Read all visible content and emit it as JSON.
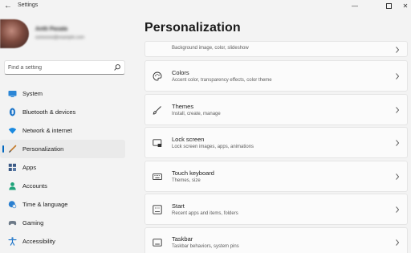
{
  "window": {
    "title": "Settings",
    "back_glyph": "←",
    "minimize_glyph": "—",
    "close_glyph": "✕"
  },
  "user": {
    "name": "Antti Pasala",
    "email": "someone@example.com"
  },
  "search": {
    "placeholder": "Find a setting",
    "icon": "search-icon"
  },
  "sidebar": {
    "accent": "#0067c0",
    "items": [
      {
        "label": "System",
        "icon": "monitor-icon"
      },
      {
        "label": "Bluetooth & devices",
        "icon": "bluetooth-icon"
      },
      {
        "label": "Network & internet",
        "icon": "wifi-icon"
      },
      {
        "label": "Personalization",
        "icon": "brush-icon",
        "active": true
      },
      {
        "label": "Apps",
        "icon": "apps-icon"
      },
      {
        "label": "Accounts",
        "icon": "person-icon"
      },
      {
        "label": "Time & language",
        "icon": "globe-clock-icon"
      },
      {
        "label": "Gaming",
        "icon": "gamepad-icon"
      },
      {
        "label": "Accessibility",
        "icon": "accessibility-icon"
      }
    ]
  },
  "main": {
    "title": "Personalization",
    "cards": [
      {
        "title": "",
        "subtitle": "Background image, color, slideshow",
        "icon": ""
      },
      {
        "title": "Colors",
        "subtitle": "Accent color, transparency effects, color theme",
        "icon": "palette-icon"
      },
      {
        "title": "Themes",
        "subtitle": "Install, create, manage",
        "icon": "brush-icon"
      },
      {
        "title": "Lock screen",
        "subtitle": "Lock screen images, apps, animations",
        "icon": "lock-screen-icon"
      },
      {
        "title": "Touch keyboard",
        "subtitle": "Themes, size",
        "icon": "keyboard-icon"
      },
      {
        "title": "Start",
        "subtitle": "Recent apps and items, folders",
        "icon": "start-icon"
      },
      {
        "title": "Taskbar",
        "subtitle": "Taskbar behaviors, system pins",
        "icon": "taskbar-icon"
      }
    ]
  }
}
